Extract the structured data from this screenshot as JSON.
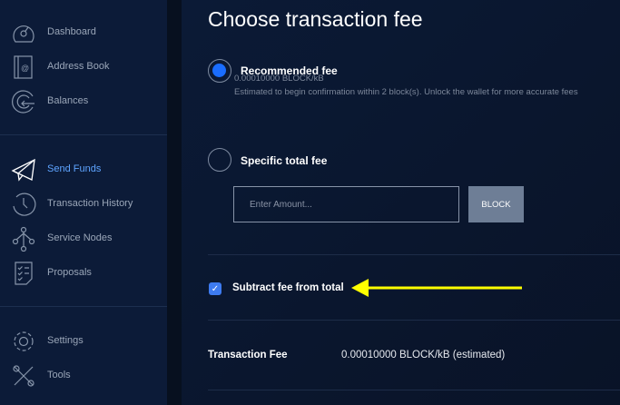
{
  "sidebar": {
    "items": [
      {
        "label": "Dashboard",
        "icon": "dashboard-icon"
      },
      {
        "label": "Address Book",
        "icon": "address-book-icon"
      },
      {
        "label": "Balances",
        "icon": "balances-icon"
      },
      {
        "label": "Send Funds",
        "icon": "send-icon",
        "active": true
      },
      {
        "label": "Transaction History",
        "icon": "history-icon"
      },
      {
        "label": "Service Nodes",
        "icon": "nodes-icon"
      },
      {
        "label": "Proposals",
        "icon": "proposals-icon"
      },
      {
        "label": "Settings",
        "icon": "gear-icon"
      },
      {
        "label": "Tools",
        "icon": "tools-icon"
      }
    ]
  },
  "main": {
    "title": "Choose transaction fee",
    "recommended": {
      "label": "Recommended fee",
      "rate": "0.00010000 BLOCK/kB",
      "note": "Estimated to begin confirmation within 2 block(s). Unlock the wallet for more accurate fees",
      "selected": true
    },
    "specific": {
      "label": "Specific total fee",
      "placeholder": "Enter Amount...",
      "unit": "BLOCK",
      "selected": false
    },
    "subtract": {
      "label": "Subtract fee from total",
      "checked": true,
      "check_glyph": "✓"
    },
    "fee_row": {
      "label": "Transaction Fee",
      "value": "0.00010000 BLOCK/kB (estimated)"
    }
  },
  "colors": {
    "accent": "#1a6dff",
    "active_nav": "#5ea4ff",
    "arrow": "#ffff00"
  }
}
